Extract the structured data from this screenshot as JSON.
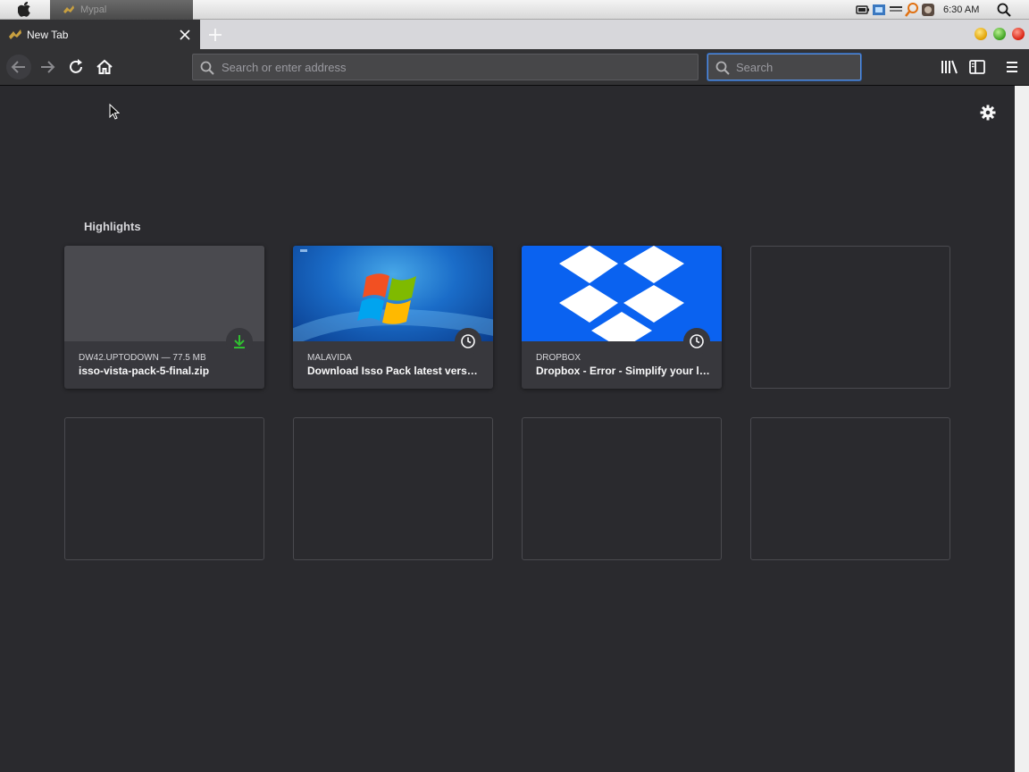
{
  "os": {
    "task_title": "Mypal",
    "clock": "6:30 AM"
  },
  "tab": {
    "title": "New Tab"
  },
  "nav": {
    "address_placeholder": "Search or enter address",
    "search_placeholder": "Search"
  },
  "highlights": {
    "title": "Highlights",
    "cards": [
      {
        "context": "DW42.UPTODOWN — 77.5 MB",
        "title": "isso-vista-pack-5-final.zip",
        "badge": "download-icon"
      },
      {
        "context": "MALAVIDA",
        "title": "Download Isso Pack latest vers…",
        "badge": "clock-icon"
      },
      {
        "context": "DROPBOX",
        "title": "Dropbox - Error - Simplify your life",
        "badge": "clock-icon"
      }
    ]
  },
  "colors": {
    "content_bg": "#2a2a2e",
    "toolbar_bg": "#323234",
    "download_green": "#30c030",
    "dropbox_blue": "#0a62f0"
  }
}
